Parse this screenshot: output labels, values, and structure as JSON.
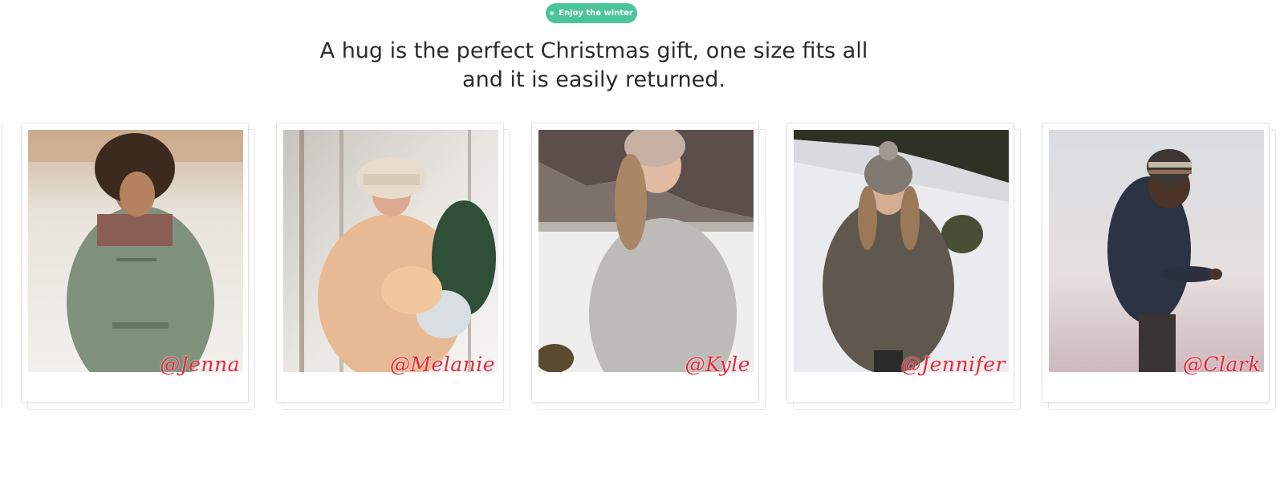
{
  "badge": {
    "label": "Enjoy the winter",
    "color": "#4cc49a"
  },
  "headline": {
    "line1": "A hug is the perfect Christmas gift, one size fits all",
    "line2": "and it is easily returned."
  },
  "gallery": {
    "cards": [
      {
        "handle": "@Jenna",
        "photo_subject": "woman-curly-hair-green-coat"
      },
      {
        "handle": "@Melanie",
        "photo_subject": "woman-bucket-hat-puffer-jacket"
      },
      {
        "handle": "@Kyle",
        "photo_subject": "woman-grey-sweatshirt-snow"
      },
      {
        "handle": "@Jennifer",
        "photo_subject": "woman-beanie-grey-hoodie"
      },
      {
        "handle": "@Clark",
        "photo_subject": "man-beanie-navy-hoodie-fog"
      }
    ],
    "handle_color": "#e8283c"
  }
}
